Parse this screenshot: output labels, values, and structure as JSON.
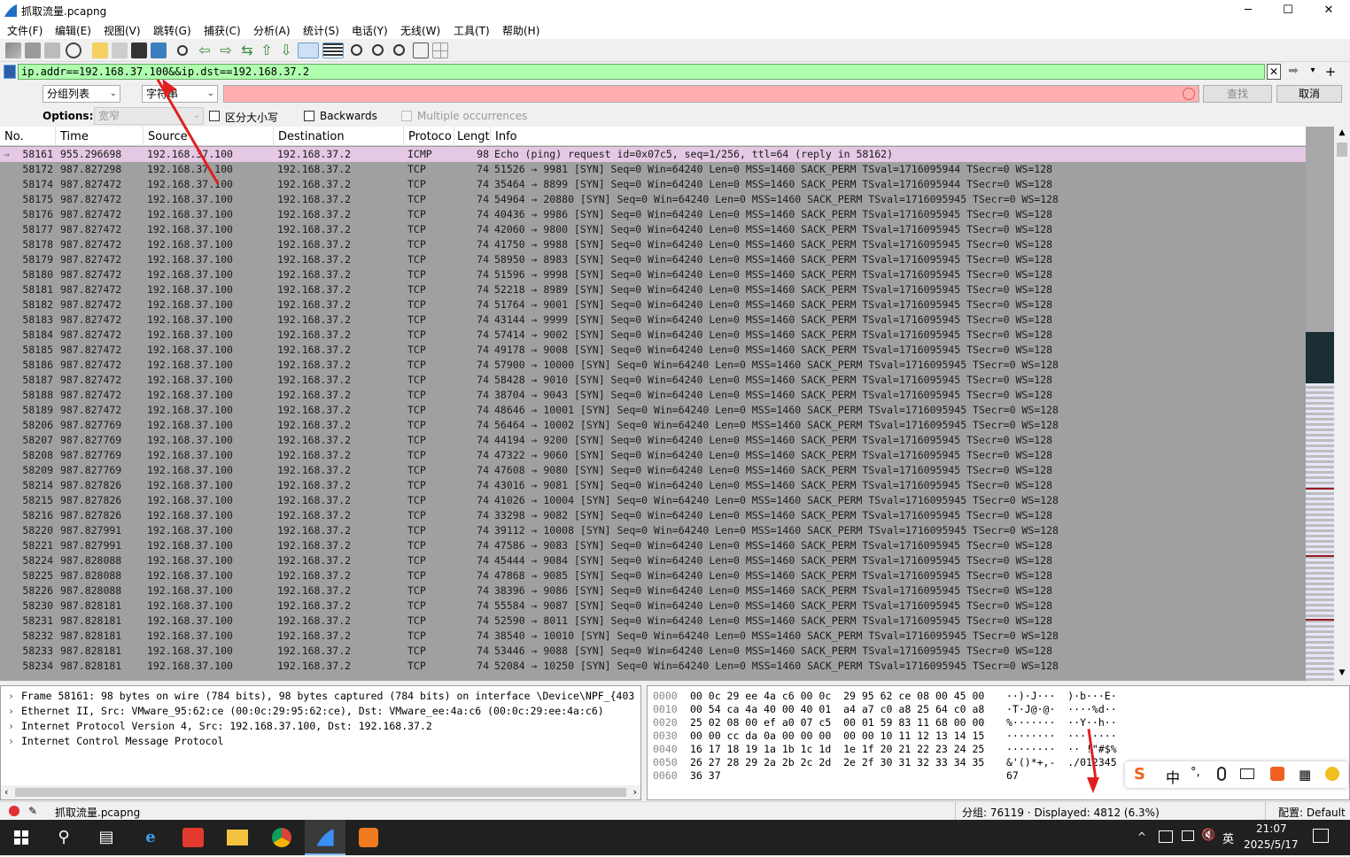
{
  "window": {
    "title": "抓取流量.pcapng",
    "min": "─",
    "max": "☐",
    "close": "✕"
  },
  "menu": [
    "文件(F)",
    "编辑(E)",
    "视图(V)",
    "跳转(G)",
    "捕获(C)",
    "分析(A)",
    "统计(S)",
    "电话(Y)",
    "无线(W)",
    "工具(T)",
    "帮助(H)"
  ],
  "filter": {
    "value": "ip.addr==192.168.37.100&&ip.dst==192.168.37.2",
    "plus": "+"
  },
  "find": {
    "type1": "分组列表",
    "type2": "字符串",
    "find_btn": "查找",
    "cancel_btn": "取消"
  },
  "options": {
    "label": "Options:",
    "combo": "宽窄",
    "case": "区分大小写",
    "backwards": "Backwards",
    "multiple": "Multiple occurrences"
  },
  "columns": {
    "no": "No.",
    "time": "Time",
    "source": "Source",
    "destination": "Destination",
    "protocol": "Protoco",
    "length": "Lengt",
    "info": "Info"
  },
  "packets": [
    [
      "58161",
      "955.296698",
      "192.168.37.100",
      "192.168.37.2",
      "ICMP",
      "98",
      "Echo (ping) request  id=0x07c5, seq=1/256, ttl=64 (reply in 58162)"
    ],
    [
      "58172",
      "987.827298",
      "192.168.37.100",
      "192.168.37.2",
      "TCP",
      "74",
      "51526 → 9981 [SYN] Seq=0 Win=64240 Len=0 MSS=1460 SACK_PERM TSval=1716095944 TSecr=0 WS=128"
    ],
    [
      "58174",
      "987.827472",
      "192.168.37.100",
      "192.168.37.2",
      "TCP",
      "74",
      "35464 → 8899 [SYN] Seq=0 Win=64240 Len=0 MSS=1460 SACK_PERM TSval=1716095944 TSecr=0 WS=128"
    ],
    [
      "58175",
      "987.827472",
      "192.168.37.100",
      "192.168.37.2",
      "TCP",
      "74",
      "54964 → 20880 [SYN] Seq=0 Win=64240 Len=0 MSS=1460 SACK_PERM TSval=1716095945 TSecr=0 WS=128"
    ],
    [
      "58176",
      "987.827472",
      "192.168.37.100",
      "192.168.37.2",
      "TCP",
      "74",
      "40436 → 9986 [SYN] Seq=0 Win=64240 Len=0 MSS=1460 SACK_PERM TSval=1716095945 TSecr=0 WS=128"
    ],
    [
      "58177",
      "987.827472",
      "192.168.37.100",
      "192.168.37.2",
      "TCP",
      "74",
      "42060 → 9800 [SYN] Seq=0 Win=64240 Len=0 MSS=1460 SACK_PERM TSval=1716095945 TSecr=0 WS=128"
    ],
    [
      "58178",
      "987.827472",
      "192.168.37.100",
      "192.168.37.2",
      "TCP",
      "74",
      "41750 → 9988 [SYN] Seq=0 Win=64240 Len=0 MSS=1460 SACK_PERM TSval=1716095945 TSecr=0 WS=128"
    ],
    [
      "58179",
      "987.827472",
      "192.168.37.100",
      "192.168.37.2",
      "TCP",
      "74",
      "58950 → 8983 [SYN] Seq=0 Win=64240 Len=0 MSS=1460 SACK_PERM TSval=1716095945 TSecr=0 WS=128"
    ],
    [
      "58180",
      "987.827472",
      "192.168.37.100",
      "192.168.37.2",
      "TCP",
      "74",
      "51596 → 9998 [SYN] Seq=0 Win=64240 Len=0 MSS=1460 SACK_PERM TSval=1716095945 TSecr=0 WS=128"
    ],
    [
      "58181",
      "987.827472",
      "192.168.37.100",
      "192.168.37.2",
      "TCP",
      "74",
      "52218 → 8989 [SYN] Seq=0 Win=64240 Len=0 MSS=1460 SACK_PERM TSval=1716095945 TSecr=0 WS=128"
    ],
    [
      "58182",
      "987.827472",
      "192.168.37.100",
      "192.168.37.2",
      "TCP",
      "74",
      "51764 → 9001 [SYN] Seq=0 Win=64240 Len=0 MSS=1460 SACK_PERM TSval=1716095945 TSecr=0 WS=128"
    ],
    [
      "58183",
      "987.827472",
      "192.168.37.100",
      "192.168.37.2",
      "TCP",
      "74",
      "43144 → 9999 [SYN] Seq=0 Win=64240 Len=0 MSS=1460 SACK_PERM TSval=1716095945 TSecr=0 WS=128"
    ],
    [
      "58184",
      "987.827472",
      "192.168.37.100",
      "192.168.37.2",
      "TCP",
      "74",
      "57414 → 9002 [SYN] Seq=0 Win=64240 Len=0 MSS=1460 SACK_PERM TSval=1716095945 TSecr=0 WS=128"
    ],
    [
      "58185",
      "987.827472",
      "192.168.37.100",
      "192.168.37.2",
      "TCP",
      "74",
      "49178 → 9008 [SYN] Seq=0 Win=64240 Len=0 MSS=1460 SACK_PERM TSval=1716095945 TSecr=0 WS=128"
    ],
    [
      "58186",
      "987.827472",
      "192.168.37.100",
      "192.168.37.2",
      "TCP",
      "74",
      "57900 → 10000 [SYN] Seq=0 Win=64240 Len=0 MSS=1460 SACK_PERM TSval=1716095945 TSecr=0 WS=128"
    ],
    [
      "58187",
      "987.827472",
      "192.168.37.100",
      "192.168.37.2",
      "TCP",
      "74",
      "58428 → 9010 [SYN] Seq=0 Win=64240 Len=0 MSS=1460 SACK_PERM TSval=1716095945 TSecr=0 WS=128"
    ],
    [
      "58188",
      "987.827472",
      "192.168.37.100",
      "192.168.37.2",
      "TCP",
      "74",
      "38704 → 9043 [SYN] Seq=0 Win=64240 Len=0 MSS=1460 SACK_PERM TSval=1716095945 TSecr=0 WS=128"
    ],
    [
      "58189",
      "987.827472",
      "192.168.37.100",
      "192.168.37.2",
      "TCP",
      "74",
      "48646 → 10001 [SYN] Seq=0 Win=64240 Len=0 MSS=1460 SACK_PERM TSval=1716095945 TSecr=0 WS=128"
    ],
    [
      "58206",
      "987.827769",
      "192.168.37.100",
      "192.168.37.2",
      "TCP",
      "74",
      "56464 → 10002 [SYN] Seq=0 Win=64240 Len=0 MSS=1460 SACK_PERM TSval=1716095945 TSecr=0 WS=128"
    ],
    [
      "58207",
      "987.827769",
      "192.168.37.100",
      "192.168.37.2",
      "TCP",
      "74",
      "44194 → 9200 [SYN] Seq=0 Win=64240 Len=0 MSS=1460 SACK_PERM TSval=1716095945 TSecr=0 WS=128"
    ],
    [
      "58208",
      "987.827769",
      "192.168.37.100",
      "192.168.37.2",
      "TCP",
      "74",
      "47322 → 9060 [SYN] Seq=0 Win=64240 Len=0 MSS=1460 SACK_PERM TSval=1716095945 TSecr=0 WS=128"
    ],
    [
      "58209",
      "987.827769",
      "192.168.37.100",
      "192.168.37.2",
      "TCP",
      "74",
      "47608 → 9080 [SYN] Seq=0 Win=64240 Len=0 MSS=1460 SACK_PERM TSval=1716095945 TSecr=0 WS=128"
    ],
    [
      "58214",
      "987.827826",
      "192.168.37.100",
      "192.168.37.2",
      "TCP",
      "74",
      "43016 → 9081 [SYN] Seq=0 Win=64240 Len=0 MSS=1460 SACK_PERM TSval=1716095945 TSecr=0 WS=128"
    ],
    [
      "58215",
      "987.827826",
      "192.168.37.100",
      "192.168.37.2",
      "TCP",
      "74",
      "41026 → 10004 [SYN] Seq=0 Win=64240 Len=0 MSS=1460 SACK_PERM TSval=1716095945 TSecr=0 WS=128"
    ],
    [
      "58216",
      "987.827826",
      "192.168.37.100",
      "192.168.37.2",
      "TCP",
      "74",
      "33298 → 9082 [SYN] Seq=0 Win=64240 Len=0 MSS=1460 SACK_PERM TSval=1716095945 TSecr=0 WS=128"
    ],
    [
      "58220",
      "987.827991",
      "192.168.37.100",
      "192.168.37.2",
      "TCP",
      "74",
      "39112 → 10008 [SYN] Seq=0 Win=64240 Len=0 MSS=1460 SACK_PERM TSval=1716095945 TSecr=0 WS=128"
    ],
    [
      "58221",
      "987.827991",
      "192.168.37.100",
      "192.168.37.2",
      "TCP",
      "74",
      "47586 → 9083 [SYN] Seq=0 Win=64240 Len=0 MSS=1460 SACK_PERM TSval=1716095945 TSecr=0 WS=128"
    ],
    [
      "58224",
      "987.828088",
      "192.168.37.100",
      "192.168.37.2",
      "TCP",
      "74",
      "45444 → 9084 [SYN] Seq=0 Win=64240 Len=0 MSS=1460 SACK_PERM TSval=1716095945 TSecr=0 WS=128"
    ],
    [
      "58225",
      "987.828088",
      "192.168.37.100",
      "192.168.37.2",
      "TCP",
      "74",
      "47868 → 9085 [SYN] Seq=0 Win=64240 Len=0 MSS=1460 SACK_PERM TSval=1716095945 TSecr=0 WS=128"
    ],
    [
      "58226",
      "987.828088",
      "192.168.37.100",
      "192.168.37.2",
      "TCP",
      "74",
      "38396 → 9086 [SYN] Seq=0 Win=64240 Len=0 MSS=1460 SACK_PERM TSval=1716095945 TSecr=0 WS=128"
    ],
    [
      "58230",
      "987.828181",
      "192.168.37.100",
      "192.168.37.2",
      "TCP",
      "74",
      "55584 → 9087 [SYN] Seq=0 Win=64240 Len=0 MSS=1460 SACK_PERM TSval=1716095945 TSecr=0 WS=128"
    ],
    [
      "58231",
      "987.828181",
      "192.168.37.100",
      "192.168.37.2",
      "TCP",
      "74",
      "52590 → 8011 [SYN] Seq=0 Win=64240 Len=0 MSS=1460 SACK_PERM TSval=1716095945 TSecr=0 WS=128"
    ],
    [
      "58232",
      "987.828181",
      "192.168.37.100",
      "192.168.37.2",
      "TCP",
      "74",
      "38540 → 10010 [SYN] Seq=0 Win=64240 Len=0 MSS=1460 SACK_PERM TSval=1716095945 TSecr=0 WS=128"
    ],
    [
      "58233",
      "987.828181",
      "192.168.37.100",
      "192.168.37.2",
      "TCP",
      "74",
      "53446 → 9088 [SYN] Seq=0 Win=64240 Len=0 MSS=1460 SACK_PERM TSval=1716095945 TSecr=0 WS=128"
    ],
    [
      "58234",
      "987.828181",
      "192.168.37.100",
      "192.168.37.2",
      "TCP",
      "74",
      "52084 → 10250 [SYN] Seq=0 Win=64240 Len=0 MSS=1460 SACK_PERM TSval=1716095945 TSecr=0 WS=128"
    ]
  ],
  "details": [
    "Frame 58161: 98 bytes on wire (784 bits), 98 bytes captured (784 bits) on interface \\Device\\NPF_{403",
    "Ethernet II, Src: VMware_95:62:ce (00:0c:29:95:62:ce), Dst: VMware_ee:4a:c6 (00:0c:29:ee:4a:c6)",
    "Internet Protocol Version 4, Src: 192.168.37.100, Dst: 192.168.37.2",
    "Internet Control Message Protocol"
  ],
  "bytes": [
    [
      "0000",
      "00 0c 29 ee 4a c6 00 0c  29 95 62 ce 08 00 45 00",
      "··)·J···  )·b···E·"
    ],
    [
      "0010",
      "00 54 ca 4a 40 00 40 01  a4 a7 c0 a8 25 64 c0 a8",
      "·T·J@·@·  ····%d··"
    ],
    [
      "0020",
      "25 02 08 00 ef a0 07 c5  00 01 59 83 11 68 00 00",
      "%·······  ··Y··h··"
    ],
    [
      "0030",
      "00 00 cc da 0a 00 00 00  00 00 10 11 12 13 14 15",
      "········  ········"
    ],
    [
      "0040",
      "16 17 18 19 1a 1b 1c 1d  1e 1f 20 21 22 23 24 25",
      "········  ·· !\"#$%"
    ],
    [
      "0050",
      "26 27 28 29 2a 2b 2c 2d  2e 2f 30 31 32 33 34 35",
      "&'()*+,-  ./012345"
    ],
    [
      "0060",
      "36 37",
      "67"
    ]
  ],
  "status": {
    "file": "抓取流量.pcapng",
    "counts": "分组: 76119 · Displayed: 4812 (6.3%)",
    "profile": "配置: Default"
  },
  "ime": {
    "cn": "中",
    "punct": "°,",
    "lang": "英"
  },
  "clock": {
    "time": "21:07",
    "date": "2025/5/17"
  },
  "colors": {
    "filter_ok": "#afffaf",
    "find_bad": "#ffafaf",
    "selected_row": "#e4c8e4",
    "list_bg": "#a0a0a0",
    "annotation_arrow": "#e02020"
  }
}
